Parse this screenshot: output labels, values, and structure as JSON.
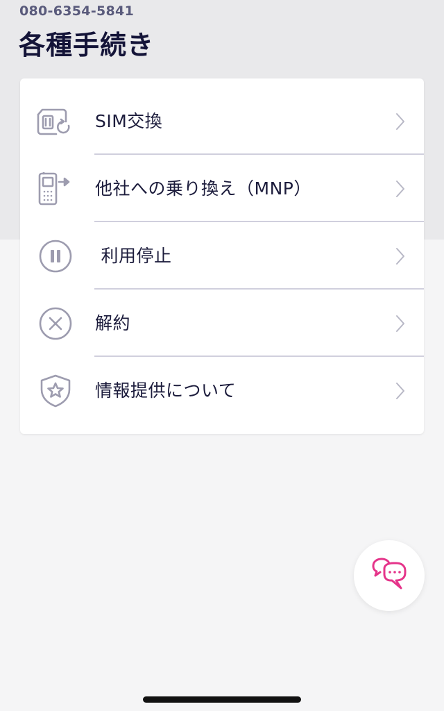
{
  "header": {
    "phone_number": "080-6354-5841",
    "title": "各種手続き"
  },
  "menu": {
    "items": [
      {
        "label": "SIM交換",
        "icon": "sim-swap-icon"
      },
      {
        "label": "他社への乗り換え（MNP）",
        "icon": "phone-transfer-icon"
      },
      {
        "label": " 利用停止",
        "icon": "pause-icon"
      },
      {
        "label": "解約",
        "icon": "cancel-x-icon"
      },
      {
        "label": "情報提供について",
        "icon": "shield-star-icon"
      }
    ]
  },
  "chat_button": {
    "icon": "chat-bubbles-icon"
  },
  "colors": {
    "icon_gray": "#9d9caf",
    "text_dark": "#1c1c3c",
    "accent_pink": "#e5348a",
    "header_bg": "#e9e9eb",
    "page_bg": "#f5f5f6"
  }
}
